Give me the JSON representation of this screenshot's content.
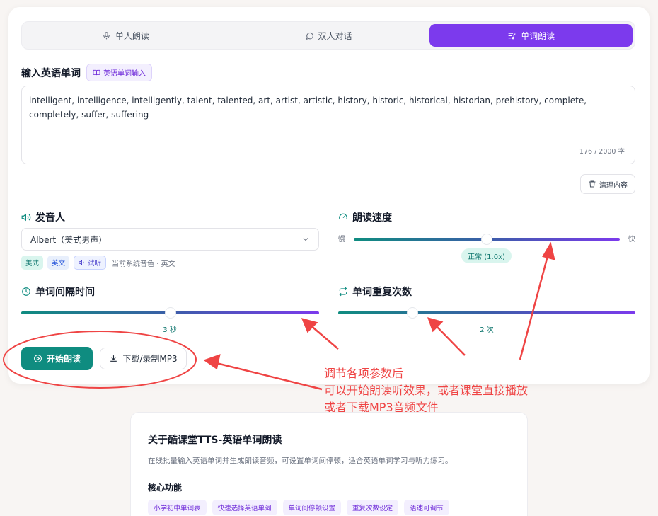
{
  "tabs": [
    {
      "label": "单人朗读",
      "icon": "microphone-icon"
    },
    {
      "label": "双人对话",
      "icon": "chat-bubble-icon"
    },
    {
      "label": "单词朗读",
      "icon": "word-list-icon"
    }
  ],
  "input": {
    "title": "输入英语单词",
    "chip": "英语单词输入",
    "text": "intelligent, intelligence, intelligently, talent, talented, art, artist, artistic, history, historic, historical, historian, prehistory, complete, completely, suffer, suffering",
    "counter": "176 / 2000 字",
    "clear_label": "清理内容"
  },
  "voice": {
    "title": "发音人",
    "selected": "Albert（美式男声）",
    "tags": [
      "美式",
      "英文"
    ],
    "audition": "试听",
    "note": "当前系统音色 · 英文"
  },
  "speed": {
    "title": "朗读速度",
    "slow": "慢",
    "fast": "快",
    "badge": "正常 (1.0x)",
    "level": 0.5
  },
  "interval": {
    "title": "单词间隔时间",
    "value": "3 秒",
    "level": 0.5
  },
  "repeat": {
    "title": "单词重复次数",
    "value": "2 次",
    "level": 0.25
  },
  "actions": {
    "play": "开始朗读",
    "download": "下载/录制MP3"
  },
  "annotation": {
    "line1": "调节各项参数后",
    "line2": "可以开始朗读听效果，或者课堂直接播放",
    "line3": "或者下载MP3音频文件",
    "color": "#ef4444"
  },
  "about": {
    "title": "关于酷课堂TTS-英语单词朗读",
    "desc": "在线批量输入英语单词并生成朗读音频，可设置单词间停顿，适合英语单词学习与听力练习。",
    "features_title": "核心功能",
    "features": [
      "小学初中单词表",
      "快速选择英语单词",
      "单词间停顿设置",
      "重复次数设定",
      "语速可调节"
    ]
  },
  "colors": {
    "accent": "#7c3aed",
    "primary": "#0f8c80"
  }
}
